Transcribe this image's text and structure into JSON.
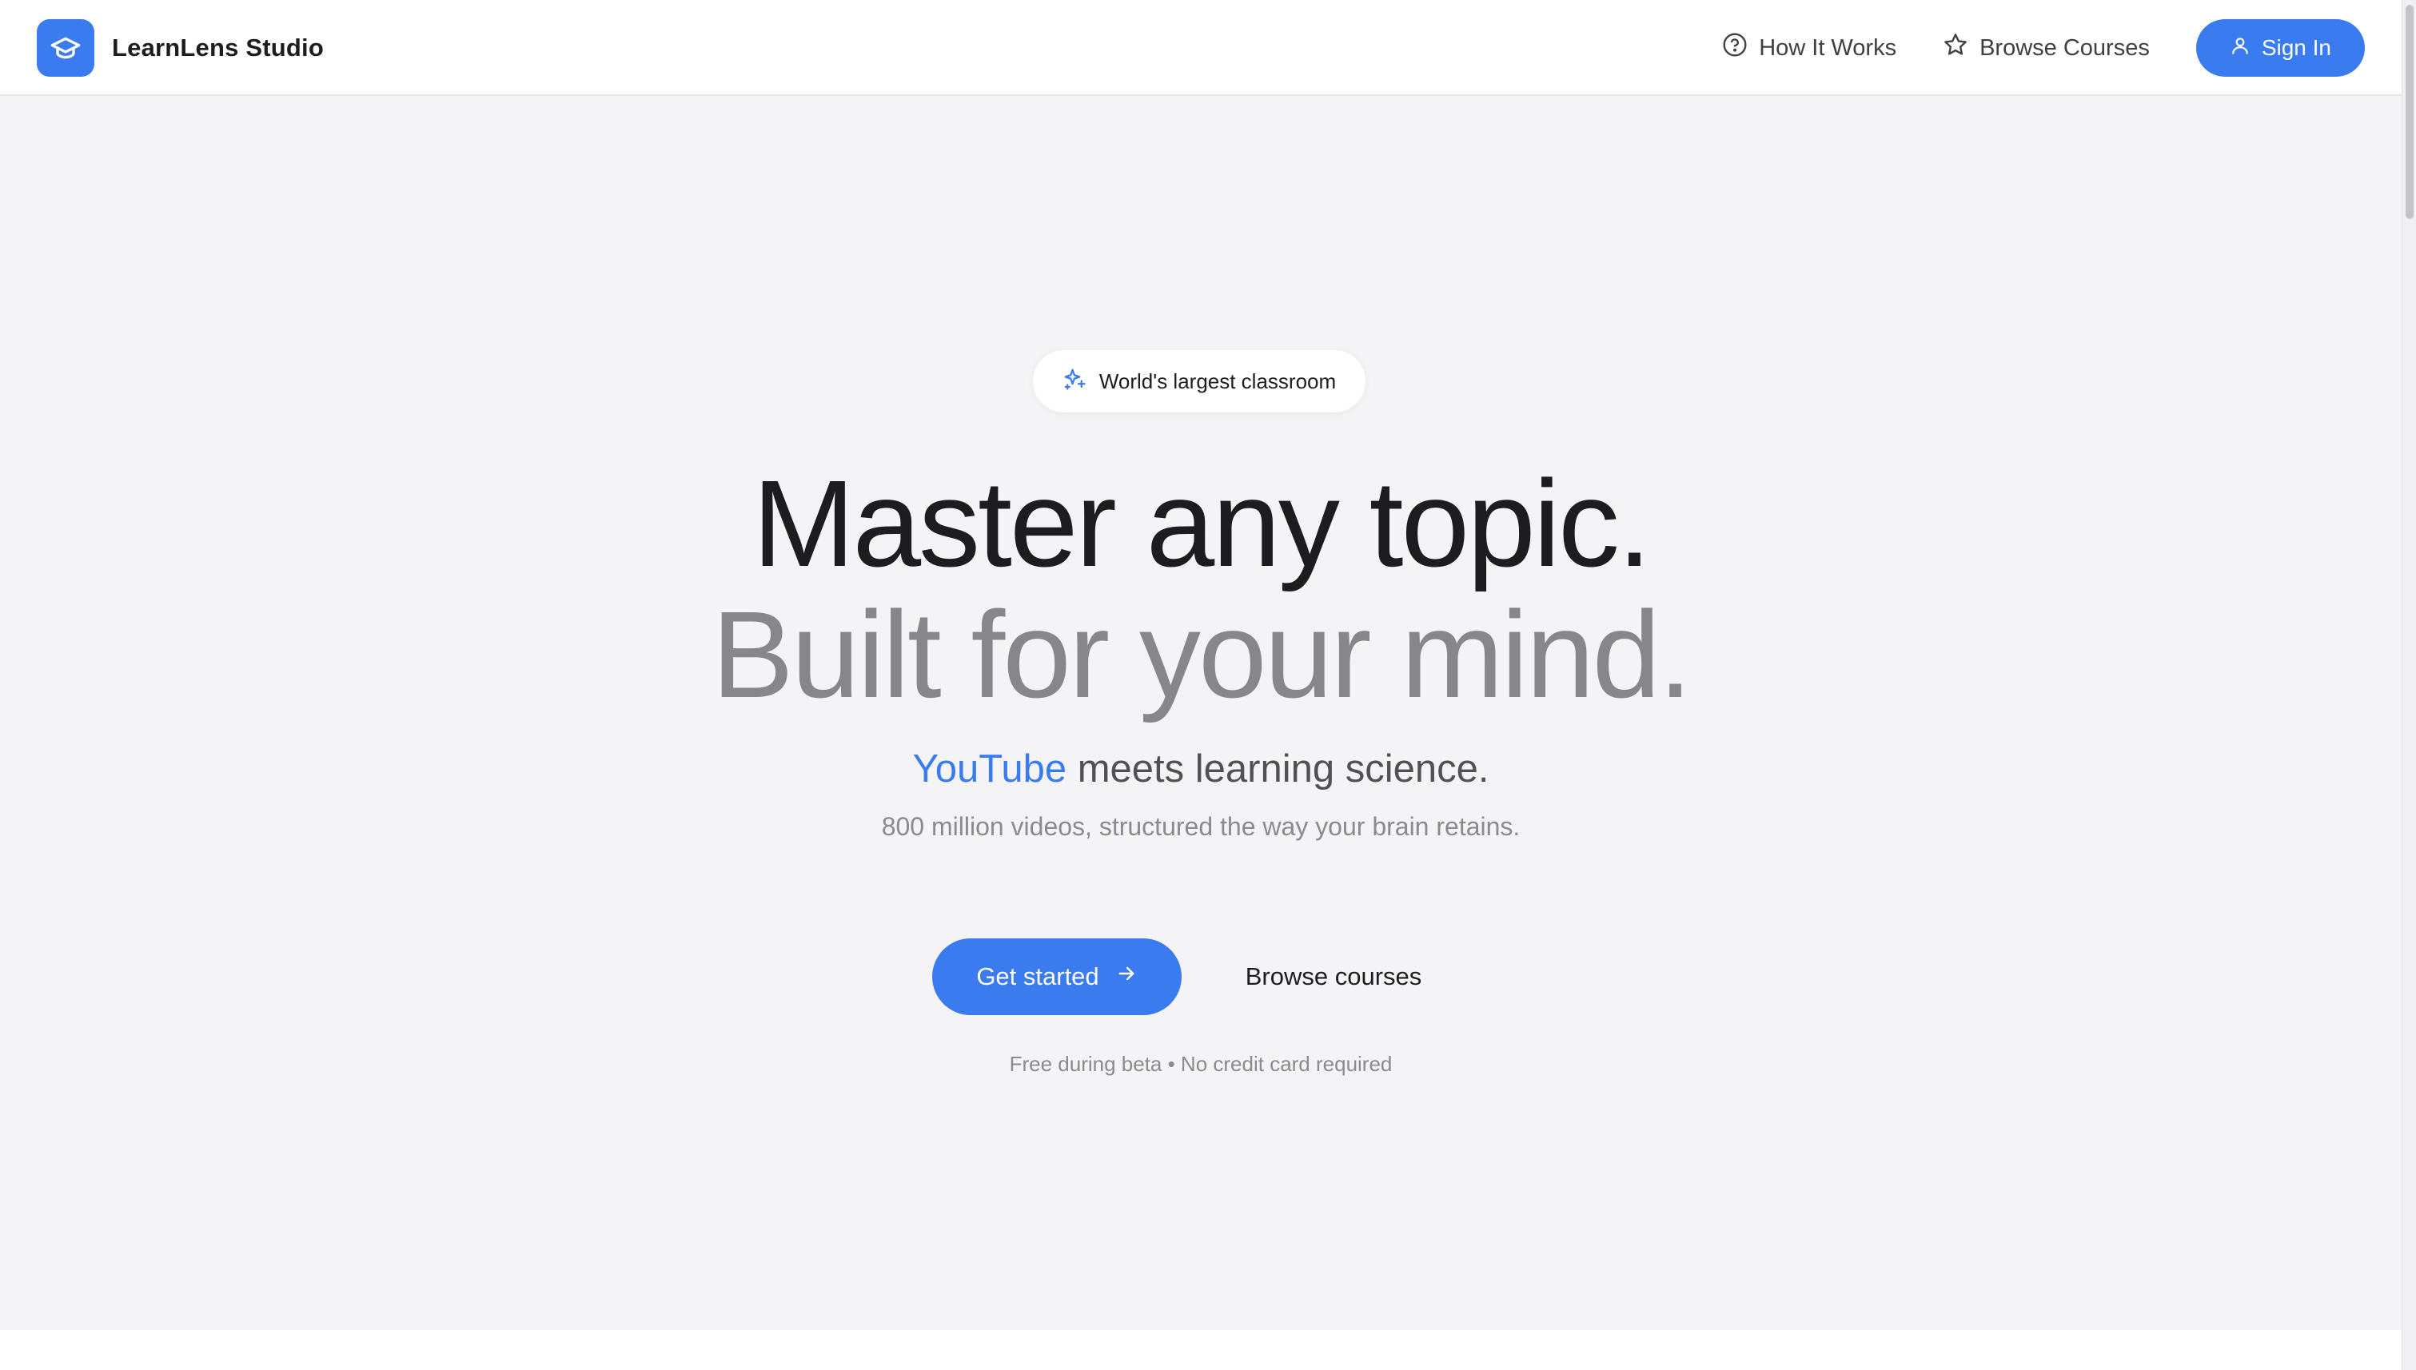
{
  "header": {
    "brand_name": "LearnLens Studio",
    "brand_icon": "graduation-cap-icon",
    "nav": [
      {
        "label": "How It Works",
        "icon": "help-circle-icon"
      },
      {
        "label": "Browse Courses",
        "icon": "star-icon"
      }
    ],
    "signin_label": "Sign In",
    "signin_icon": "user-icon"
  },
  "hero": {
    "badge_label": "World's largest classroom",
    "badge_icon": "sparkles-icon",
    "headline_line1": "Master any topic.",
    "headline_line2": "Built for your mind.",
    "tagline_accent": "YouTube",
    "tagline_rest": "meets learning science.",
    "subline": "800 million videos, structured the way your brain retains.",
    "cta_primary": "Get started",
    "cta_primary_icon": "arrow-right-icon",
    "cta_secondary": "Browse courses",
    "note": "Free during beta • No credit card required"
  },
  "colors": {
    "accent": "#3b7bf0",
    "background": "#f4f4f6",
    "headline_primary": "#1d1d1f",
    "headline_secondary": "#86868b"
  }
}
